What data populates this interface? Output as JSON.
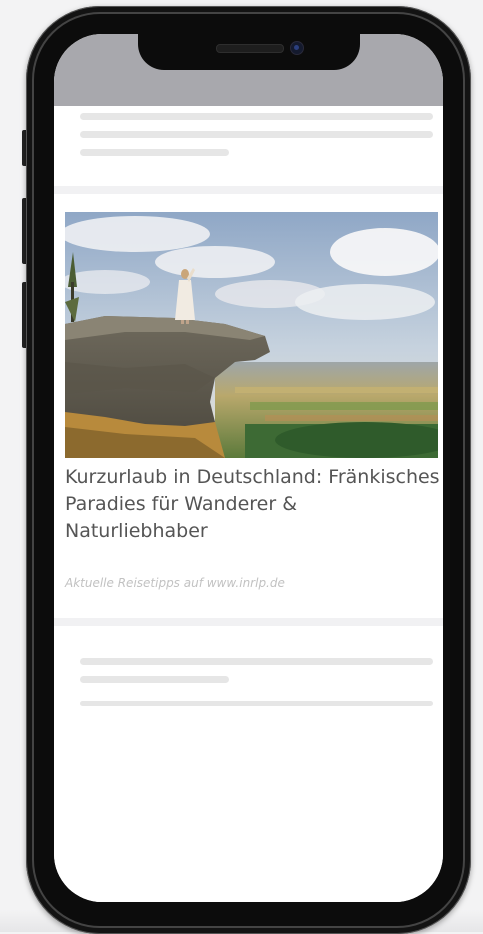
{
  "article": {
    "title": "Kurzurlaub in Deutschland: Fränkisches Paradies für Wanderer & Naturliebhaber",
    "source": "Aktuelle Reisetipps auf www.inrlp.de",
    "image_subject": "woman-on-rock-cliff-landscape"
  },
  "colors": {
    "statusbar": "#a8a8ad",
    "placeholder": "#e6e6e6",
    "frame": "#131313",
    "title_text": "#555555",
    "source_text": "#c2c2c2"
  }
}
